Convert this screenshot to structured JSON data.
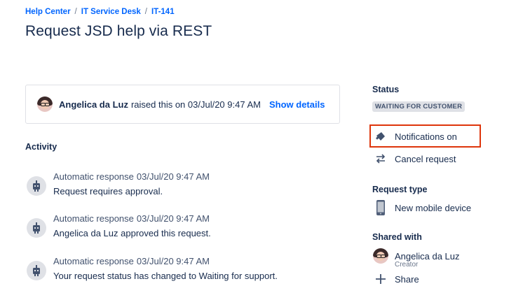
{
  "breadcrumb": {
    "items": [
      "Help Center",
      "IT Service Desk",
      "IT-141"
    ],
    "separator": "/"
  },
  "title": "Request JSD help via REST",
  "request": {
    "reporter": "Angelica da Luz",
    "raised_text": "raised this on 03/Jul/20 9:47 AM",
    "show_details": "Show details"
  },
  "activity": {
    "heading": "Activity",
    "items": [
      {
        "author": "Automatic response",
        "time": "03/Jul/20 9:47 AM",
        "text": "Request requires approval."
      },
      {
        "author": "Automatic response",
        "time": "03/Jul/20 9:47 AM",
        "text": "Angelica da Luz approved this request."
      },
      {
        "author": "Automatic response",
        "time": "03/Jul/20 9:47 AM",
        "text": "Your request status has changed to Waiting for support."
      }
    ]
  },
  "sidebar": {
    "status_heading": "Status",
    "status_value": "WAITING FOR CUSTOMER",
    "notifications_label": "Notifications on",
    "cancel_label": "Cancel request",
    "request_type_heading": "Request type",
    "request_type_value": "New mobile device",
    "shared_heading": "Shared with",
    "shared_user": "Angelica da Luz",
    "shared_role": "Creator",
    "share_label": "Share"
  },
  "colors": {
    "link": "#0065ff",
    "text": "#172b4d",
    "highlight_border": "#de350b",
    "badge_bg": "#dfe1e6"
  },
  "icons": [
    "megaphone-icon",
    "swap-arrows-icon",
    "mobile-phone-icon",
    "plus-icon",
    "robot-icon"
  ]
}
